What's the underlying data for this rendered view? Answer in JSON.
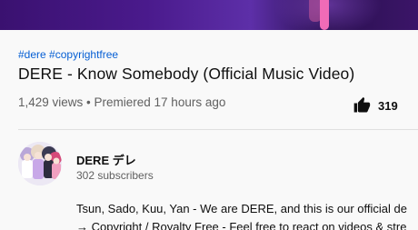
{
  "hashtags": [
    "#dere",
    "#copyrightfree"
  ],
  "video": {
    "title": "DERE - Know Somebody (Official Music Video)",
    "meta": "1,429 views • Premiered 17 hours ago",
    "likes": "319"
  },
  "channel": {
    "name": "DERE デレ",
    "subscribers": "302 subscribers"
  },
  "description": {
    "line1": "Tsun, Sado, Kuu, Yan - We are DERE, and this is our official de",
    "line2": "→ Copyright / Royalty Free - Feel free to react on videos & stre"
  },
  "colors": {
    "link": "#065fd4",
    "secondary_text": "#606060",
    "primary_text": "#0f0f0f"
  },
  "icons": {
    "like": "thumb-up-icon"
  }
}
